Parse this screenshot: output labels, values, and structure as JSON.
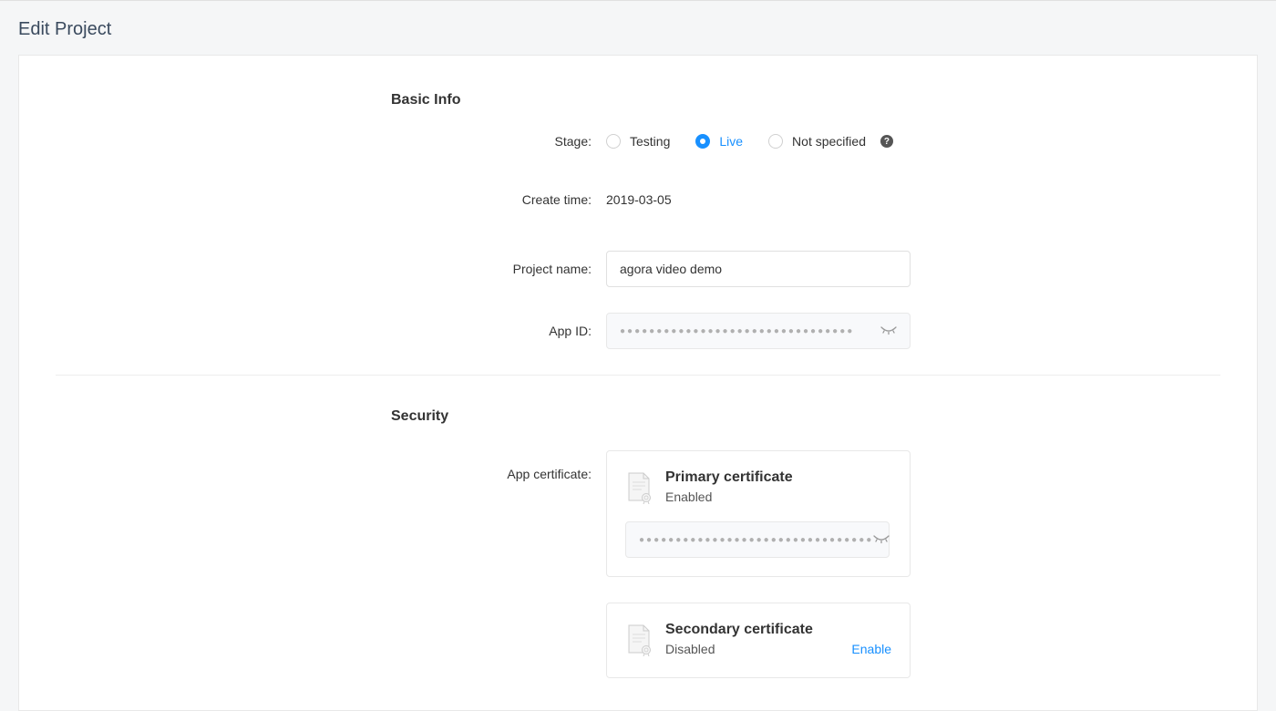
{
  "page": {
    "title": "Edit Project"
  },
  "basicInfo": {
    "sectionTitle": "Basic Info",
    "stage": {
      "label": "Stage:",
      "options": {
        "testing": "Testing",
        "live": "Live",
        "notSpecified": "Not specified"
      },
      "selected": "live"
    },
    "createTime": {
      "label": "Create time:",
      "value": "2019-03-05"
    },
    "projectName": {
      "label": "Project name:",
      "value": "agora video demo"
    },
    "appId": {
      "label": "App ID:",
      "masked": "●●●●●●●●●●●●●●●●●●●●●●●●●●●●●●●●"
    }
  },
  "security": {
    "sectionTitle": "Security",
    "appCertificate": {
      "label": "App certificate:"
    },
    "primary": {
      "title": "Primary certificate",
      "status": "Enabled",
      "masked": "●●●●●●●●●●●●●●●●●●●●●●●●●●●●●●●●"
    },
    "secondary": {
      "title": "Secondary certificate",
      "status": "Disabled",
      "enableLabel": "Enable"
    }
  }
}
